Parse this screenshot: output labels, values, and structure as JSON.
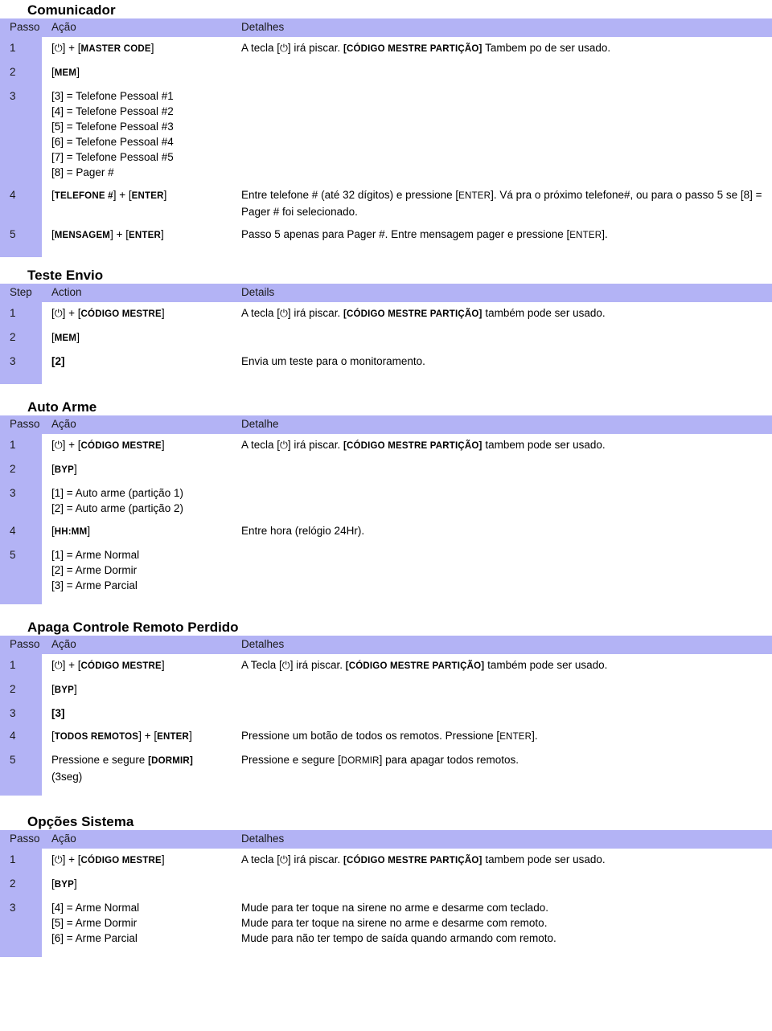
{
  "document": {
    "sections": [
      {
        "title": "Comunicador",
        "columns": {
          "step": "Passo",
          "action": "Ação",
          "details": "Detalhes"
        },
        "rows": [
          {
            "step": "1",
            "action_parts": [
              {
                "t": "[",
                "s": "plain"
              },
              {
                "t": "power-icon",
                "s": "icon"
              },
              {
                "t": "] + [",
                "s": "plain"
              },
              {
                "t": "MASTER CODE",
                "s": "smallcaps-bold"
              },
              {
                "t": "]",
                "s": "plain"
              }
            ],
            "details_parts": [
              {
                "t": "A tecla [",
                "s": "plain"
              },
              {
                "t": "power-icon",
                "s": "icon"
              },
              {
                "t": "] irá piscar. ",
                "s": "plain"
              },
              {
                "t": "[CÓDIGO MESTRE PARTIÇÃO]",
                "s": "smallcaps-bold"
              },
              {
                "t": " Tambem po de ser usado.",
                "s": "plain"
              }
            ]
          },
          {
            "step": "2",
            "action_parts": [
              {
                "t": "[",
                "s": "plain"
              },
              {
                "t": "MEM",
                "s": "smallcaps-bold"
              },
              {
                "t": "]",
                "s": "plain"
              }
            ],
            "details_parts": []
          },
          {
            "step": "3",
            "action_lines": [
              "[3] = Telefone Pessoal #1",
              "[4] = Telefone Pessoal #2",
              "[5] = Telefone Pessoal #3",
              "[6] = Telefone Pessoal #4",
              "[7] = Telefone Pessoal #5",
              "[8] = Pager #"
            ],
            "details_parts": []
          },
          {
            "step": "4",
            "action_parts": [
              {
                "t": "[",
                "s": "plain"
              },
              {
                "t": "TELEFONE #",
                "s": "smallcaps-bold"
              },
              {
                "t": "] + [",
                "s": "plain"
              },
              {
                "t": "ENTER",
                "s": "smallcaps-bold"
              },
              {
                "t": "]",
                "s": "plain"
              }
            ],
            "details_parts": [
              {
                "t": "Entre telefone # (até 32 dígitos) e pressione [",
                "s": "plain"
              },
              {
                "t": "ENTER",
                "s": "smallcaps-plain"
              },
              {
                "t": "]. Vá pra o próximo telefone#, ou para o passo 5 se [8] = Pager # foi selecionado.",
                "s": "plain"
              }
            ]
          },
          {
            "step": "5",
            "action_parts": [
              {
                "t": "[",
                "s": "plain"
              },
              {
                "t": "MENSAGEM",
                "s": "smallcaps-bold"
              },
              {
                "t": "] + [",
                "s": "plain"
              },
              {
                "t": "ENTER",
                "s": "smallcaps-bold"
              },
              {
                "t": "]",
                "s": "plain"
              }
            ],
            "details_parts": [
              {
                "t": "Passo 5 apenas para Pager #. Entre mensagem pager e pressione [",
                "s": "plain"
              },
              {
                "t": "ENTER",
                "s": "smallcaps-plain"
              },
              {
                "t": "].",
                "s": "plain"
              }
            ]
          }
        ]
      },
      {
        "title": "Teste Envio",
        "columns": {
          "step": "Step",
          "action": "Action",
          "details": "Details"
        },
        "rows": [
          {
            "step": "1",
            "action_parts": [
              {
                "t": "[",
                "s": "plain"
              },
              {
                "t": "power-icon",
                "s": "icon"
              },
              {
                "t": "] + [",
                "s": "plain"
              },
              {
                "t": "CÓDIGO MESTRE",
                "s": "smallcaps-bold"
              },
              {
                "t": "]",
                "s": "plain"
              }
            ],
            "details_parts": [
              {
                "t": "A tecla [",
                "s": "plain"
              },
              {
                "t": "power-icon",
                "s": "icon"
              },
              {
                "t": "] irá piscar. ",
                "s": "plain"
              },
              {
                "t": "[CÓDIGO MESTRE PARTIÇÃO]",
                "s": "smallcaps-bold"
              },
              {
                "t": " também pode ser usado.",
                "s": "plain"
              }
            ]
          },
          {
            "step": "2",
            "action_parts": [
              {
                "t": "[",
                "s": "plain"
              },
              {
                "t": "MEM",
                "s": "smallcaps-bold"
              },
              {
                "t": "]",
                "s": "plain"
              }
            ],
            "details_parts": []
          },
          {
            "step": "3",
            "action_parts": [
              {
                "t": "[2]",
                "s": "bold"
              }
            ],
            "details_parts": [
              {
                "t": "Envia um teste para o monitoramento.",
                "s": "plain"
              }
            ]
          }
        ]
      },
      {
        "title": "Auto Arme",
        "columns": {
          "step": "Passo",
          "action": "Ação",
          "details": "Detalhe"
        },
        "rows": [
          {
            "step": "1",
            "action_parts": [
              {
                "t": "[",
                "s": "plain"
              },
              {
                "t": "power-icon",
                "s": "icon"
              },
              {
                "t": "] + [",
                "s": "plain"
              },
              {
                "t": "CÓDIGO MESTRE",
                "s": "smallcaps-bold"
              },
              {
                "t": "]",
                "s": "plain"
              }
            ],
            "details_parts": [
              {
                "t": "A tecla [",
                "s": "plain"
              },
              {
                "t": "power-icon",
                "s": "icon"
              },
              {
                "t": "] irá piscar. ",
                "s": "plain"
              },
              {
                "t": "[CÓDIGO MESTRE PARTIÇÃO]",
                "s": "smallcaps-bold"
              },
              {
                "t": " tambem pode ser usado.",
                "s": "plain"
              }
            ]
          },
          {
            "step": "2",
            "action_parts": [
              {
                "t": "[",
                "s": "plain"
              },
              {
                "t": "BYP",
                "s": "smallcaps-bold"
              },
              {
                "t": "]",
                "s": "plain"
              }
            ],
            "details_parts": []
          },
          {
            "step": "3",
            "action_lines": [
              "[1] = Auto arme (partição 1)",
              "[2] = Auto arme (partição 2)"
            ],
            "details_parts": []
          },
          {
            "step": "4",
            "action_parts": [
              {
                "t": "[",
                "s": "plain"
              },
              {
                "t": "HH:MM",
                "s": "smallcaps-bold"
              },
              {
                "t": "]",
                "s": "plain"
              }
            ],
            "details_parts": [
              {
                "t": "Entre hora (relógio 24Hr).",
                "s": "plain"
              }
            ]
          },
          {
            "step": "5",
            "action_lines": [
              "[1] = Arme Normal",
              "[2] = Arme Dormir",
              "[3] = Arme Parcial"
            ],
            "details_parts": []
          }
        ]
      },
      {
        "title": "Apaga Controle Remoto Perdido",
        "columns": {
          "step": "Passo",
          "action": "Ação",
          "details": "Detalhes"
        },
        "rows": [
          {
            "step": "1",
            "action_parts": [
              {
                "t": "[",
                "s": "plain"
              },
              {
                "t": "power-icon",
                "s": "icon"
              },
              {
                "t": "] + [",
                "s": "plain"
              },
              {
                "t": "CÓDIGO MESTRE",
                "s": "smallcaps-bold"
              },
              {
                "t": "]",
                "s": "plain"
              }
            ],
            "details_parts": [
              {
                "t": "A Tecla [",
                "s": "plain"
              },
              {
                "t": "power-icon",
                "s": "icon"
              },
              {
                "t": "] irá piscar. ",
                "s": "plain"
              },
              {
                "t": "[CÓDIGO MESTRE PARTIÇÃO]",
                "s": "smallcaps-bold"
              },
              {
                "t": " também pode ser usado.",
                "s": "plain"
              }
            ]
          },
          {
            "step": "2",
            "action_parts": [
              {
                "t": "[",
                "s": "plain"
              },
              {
                "t": "BYP",
                "s": "smallcaps-bold"
              },
              {
                "t": "]",
                "s": "plain"
              }
            ],
            "details_parts": []
          },
          {
            "step": "3",
            "action_parts": [
              {
                "t": "[3]",
                "s": "bold"
              }
            ],
            "details_parts": []
          },
          {
            "step": "4",
            "action_parts": [
              {
                "t": "[",
                "s": "plain"
              },
              {
                "t": "TODOS REMOTOS",
                "s": "smallcaps-bold"
              },
              {
                "t": "] + [",
                "s": "plain"
              },
              {
                "t": "ENTER",
                "s": "smallcaps-bold"
              },
              {
                "t": "]",
                "s": "plain"
              }
            ],
            "details_parts": [
              {
                "t": "Pressione um botão de todos os remotos. Pressione [",
                "s": "plain"
              },
              {
                "t": "ENTER",
                "s": "smallcaps-plain"
              },
              {
                "t": "].",
                "s": "plain"
              }
            ]
          },
          {
            "step": "5",
            "action_parts": [
              {
                "t": "Pressione e segure ",
                "s": "plain"
              },
              {
                "t": "[DORMIR]",
                "s": "smallcaps-bold"
              },
              {
                "t": "\n(3seg)",
                "s": "plain-newline"
              }
            ],
            "details_parts": [
              {
                "t": "Pressione e segure [",
                "s": "plain"
              },
              {
                "t": "DORMIR",
                "s": "smallcaps-plain"
              },
              {
                "t": "] para apagar todos remotos.",
                "s": "plain"
              }
            ]
          }
        ]
      },
      {
        "title": "Opções Sistema",
        "columns": {
          "step": "Passo",
          "action": "Ação",
          "details": "Detalhes"
        },
        "rows": [
          {
            "step": "1",
            "action_parts": [
              {
                "t": "[",
                "s": "plain"
              },
              {
                "t": "power-icon",
                "s": "icon"
              },
              {
                "t": "] + [",
                "s": "plain"
              },
              {
                "t": "CÓDIGO MESTRE",
                "s": "smallcaps-bold"
              },
              {
                "t": "]",
                "s": "plain"
              }
            ],
            "details_parts": [
              {
                "t": "A tecla [",
                "s": "plain"
              },
              {
                "t": "power-icon",
                "s": "icon"
              },
              {
                "t": "] irá piscar. ",
                "s": "plain"
              },
              {
                "t": "[CÓDIGO MESTRE PARTIÇÃO]",
                "s": "smallcaps-bold"
              },
              {
                "t": " tambem pode ser usado.",
                "s": "plain"
              }
            ]
          },
          {
            "step": "2",
            "action_parts": [
              {
                "t": "[",
                "s": "plain"
              },
              {
                "t": "BYP",
                "s": "smallcaps-bold"
              },
              {
                "t": "]",
                "s": "plain"
              }
            ],
            "details_parts": []
          },
          {
            "step": "3",
            "action_lines": [
              "[4] = Arme Normal",
              "[5] = Arme Dormir",
              "[6] = Arme Parcial"
            ],
            "details_lines": [
              "Mude para ter toque na sirene no arme e desarme com teclado.",
              "Mude para ter toque na sirene no arme e desarme com remoto.",
              "Mude para não ter tempo de saída quando armando com remoto."
            ]
          }
        ]
      }
    ]
  },
  "colors": {
    "header_purple": "#b3b3f5",
    "text": "#000000",
    "page_background": "#ffffff"
  },
  "icons": {
    "power": "⏻"
  }
}
